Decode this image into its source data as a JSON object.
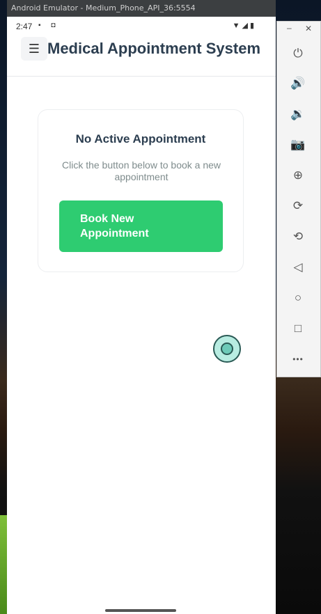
{
  "window": {
    "title": "Android Emulator - Medium_Phone_API_36:5554"
  },
  "status_bar": {
    "time": "2:47",
    "left_icons": "▪ ◘",
    "right_icons": "▼◢▮"
  },
  "header": {
    "menu_icon": "☰",
    "title": "Medical Appointment System"
  },
  "card": {
    "title": "No Active Appointment",
    "subtitle": "Click the button below to book a new appointment",
    "button_label": "Book New Appointment"
  },
  "side_toolbar": {
    "minimize": "–",
    "close": "✕",
    "tools": [
      {
        "name": "power-icon",
        "glyph": "⏻"
      },
      {
        "name": "volume-up-icon",
        "glyph": "🔊"
      },
      {
        "name": "volume-down-icon",
        "glyph": "🔉"
      },
      {
        "name": "camera-icon",
        "glyph": "📷"
      },
      {
        "name": "zoom-icon",
        "glyph": "⊕"
      },
      {
        "name": "rotate-right-icon",
        "glyph": "⟳"
      },
      {
        "name": "rotate-left-icon",
        "glyph": "⟲"
      },
      {
        "name": "back-icon",
        "glyph": "◁"
      },
      {
        "name": "home-icon",
        "glyph": "○"
      },
      {
        "name": "overview-icon",
        "glyph": "□"
      },
      {
        "name": "more-icon",
        "glyph": "•••"
      }
    ]
  },
  "colors": {
    "accent": "#2ecc71",
    "title": "#2c3e50",
    "muted": "#7f8c8d"
  }
}
